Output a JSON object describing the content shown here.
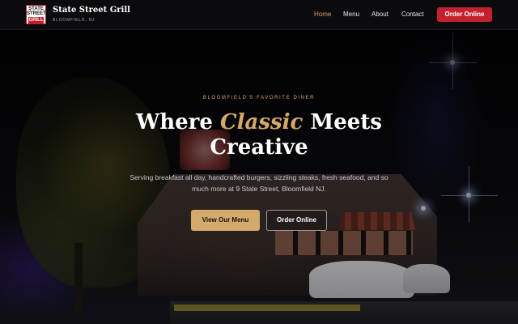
{
  "header": {
    "logo": {
      "line1": "STATE",
      "line2": "STREET",
      "line3": "GRILL"
    },
    "brand_name": "State Street Grill",
    "brand_location": "BLOOMFIELD, NJ",
    "nav": [
      {
        "label": "Home",
        "active": true
      },
      {
        "label": "Menu",
        "active": false
      },
      {
        "label": "About",
        "active": false
      },
      {
        "label": "Contact",
        "active": false
      }
    ],
    "order_button": "Order Online"
  },
  "hero": {
    "eyebrow": "BLOOMFIELD'S FAVORITE DINER",
    "title_before": "Where ",
    "title_emphasis": "Classic",
    "title_after": " Meets Creative",
    "subtitle": "Serving breakfast all day, handcrafted burgers, sizzling steaks, fresh seafood, and so much more at 9 State Street, Bloomfield NJ.",
    "primary_button": "View Our Menu",
    "secondary_button": "Order Online"
  },
  "colors": {
    "accent_gold": "#d4a868",
    "brand_red": "#c4202f",
    "header_bg": "#0c0c0e"
  }
}
